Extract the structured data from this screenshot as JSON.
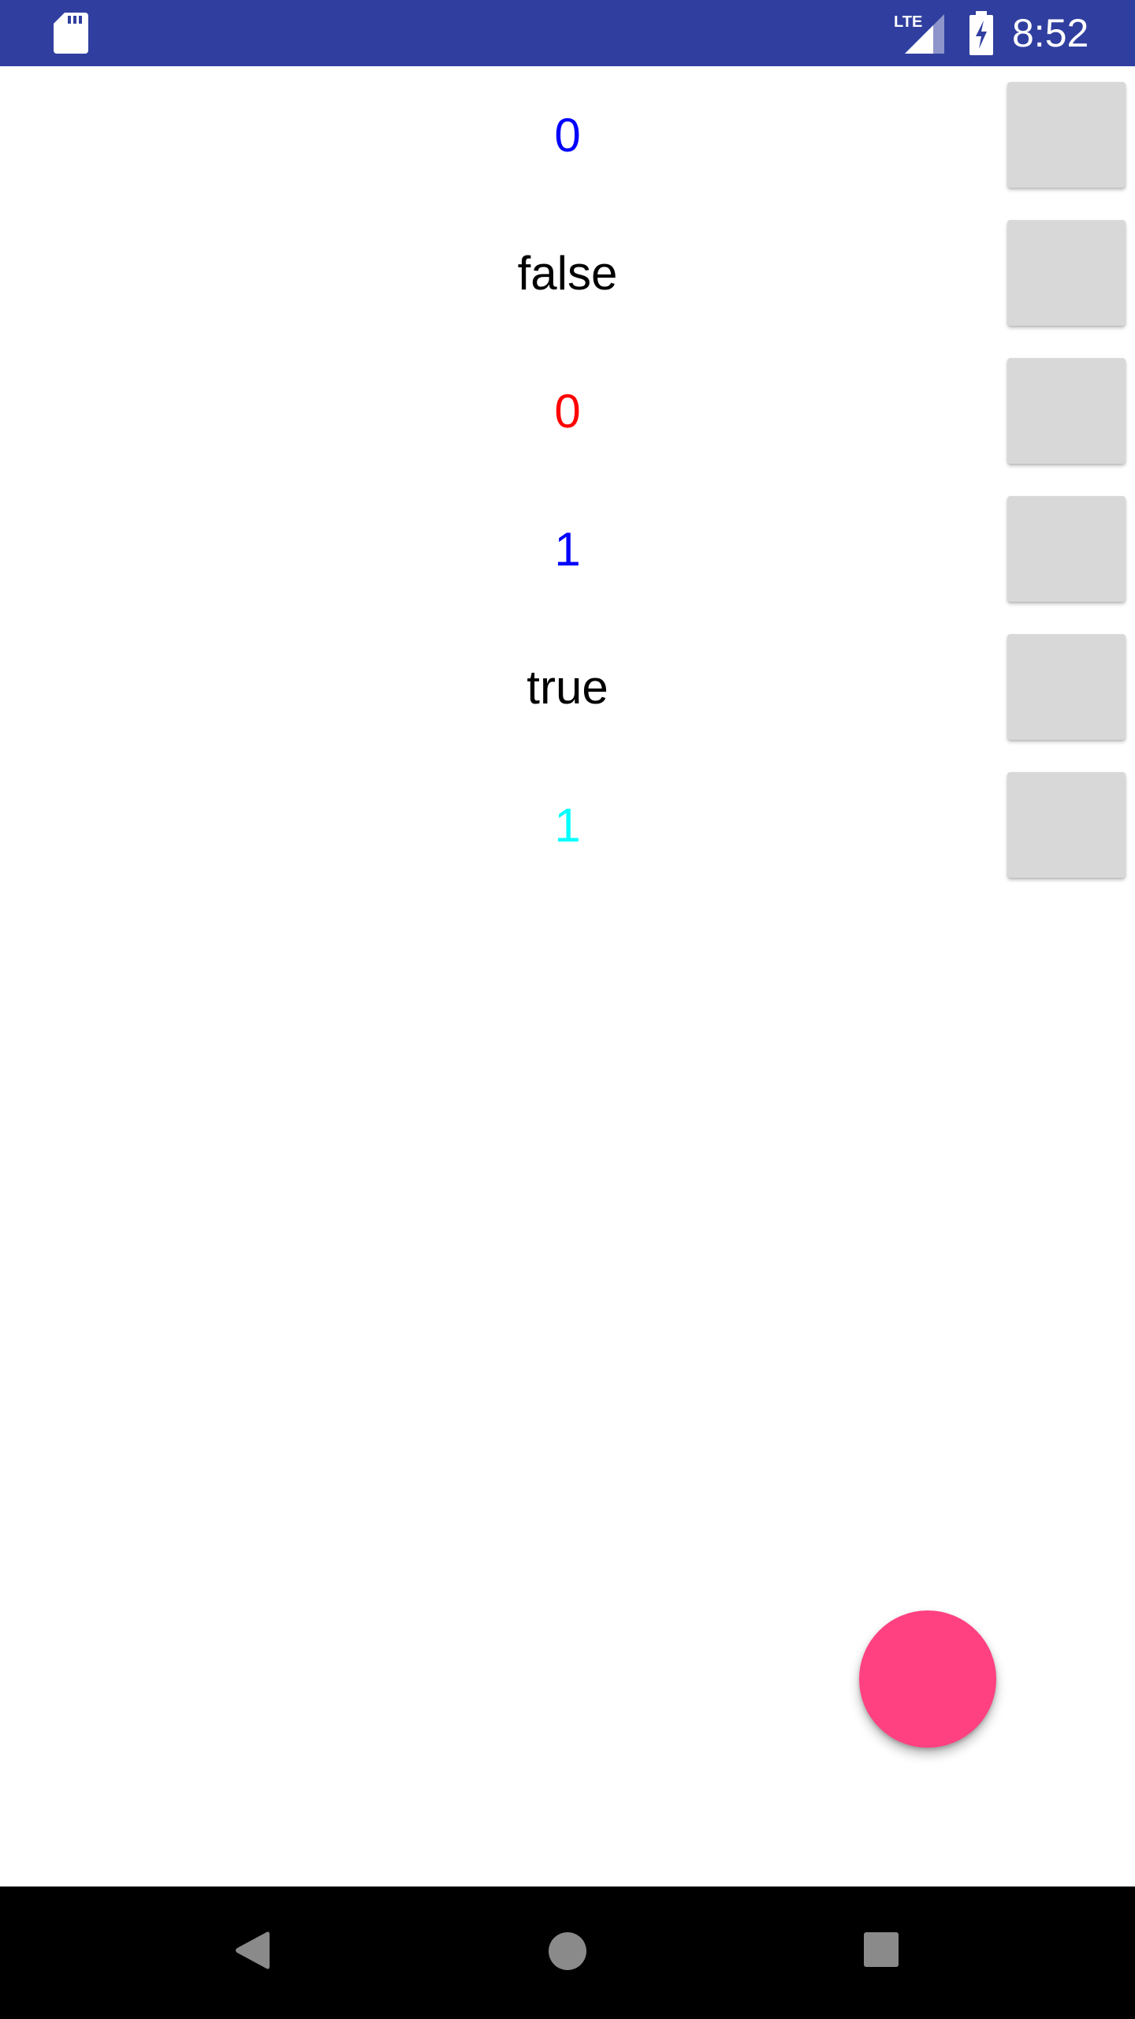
{
  "status_bar": {
    "time": "8:52",
    "network_label": "LTE",
    "background_color": "#303f9f",
    "icons": [
      "sd-card-icon",
      "lte-signal-icon",
      "battery-charging-icon"
    ]
  },
  "rows": [
    {
      "value": "0",
      "color": "#0000ff"
    },
    {
      "value": "false",
      "color": "#000000"
    },
    {
      "value": "0",
      "color": "#ff0000"
    },
    {
      "value": "1",
      "color": "#0000ff"
    },
    {
      "value": "true",
      "color": "#000000"
    },
    {
      "value": "1",
      "color": "#00ffff"
    }
  ],
  "fab": {
    "color": "#ff4081"
  },
  "nav_bar": {
    "icons": [
      "back-icon",
      "home-icon",
      "recents-icon"
    ]
  }
}
